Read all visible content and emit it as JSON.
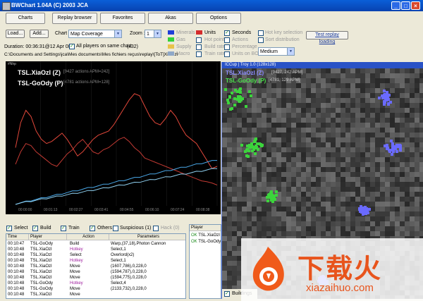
{
  "window": {
    "title": "BWChart 1.04A (C) 2003 JCA"
  },
  "tabs": [
    "Charts",
    "Replay browser",
    "Favorites",
    "Akas",
    "Options"
  ],
  "toolbar": {
    "load_label": "Load...",
    "add_label": "Add...",
    "chart_label": "Chart",
    "chart_value": "Map Coverage",
    "zoom_label": "Zoom :",
    "zoom_value": "1",
    "all_players_label": "All players on same chart",
    "zoom_factor": "(x32)",
    "duration": "Duration: 00:36:31@12 Apr 08",
    "path": "C:\\Documents and Settings\\jca\\Mes documents\\Mes fichiers reçus\\replay\\[ToT]XiaOzI",
    "test_replay_label": "Test replay loading",
    "medium_value": "Medium"
  },
  "options": {
    "minerals": "Minerals",
    "gas": "Gas",
    "supply": "Supply",
    "macro": "Macro",
    "units": "Units",
    "hot_points": "Hot points",
    "build_rate": "Build rate",
    "train_rate": "Train rate",
    "seconds": "Seconds",
    "actions": "Actions",
    "percentage": "Percentage",
    "units_on_bo": "Units on BO",
    "hot_key_selection": "Hot key selection",
    "sort_distribution": "Sort distribution"
  },
  "colors": {
    "minerals": "#1f3fd8",
    "gas": "#33d13a",
    "supply": "#e8c34a",
    "macro": "#8fa8c8",
    "units": "#d42c2c",
    "series1": "#e0473a",
    "series2": "#a8d4f0"
  },
  "graph": {
    "ylabel": "#Nhp",
    "players": [
      {
        "name": "TSL.XiaOzI (Z)",
        "stats": "[9427 actions APM=242]"
      },
      {
        "name": "TSL-GoOdy (P)",
        "stats": "[4781 actions APM=128]"
      }
    ],
    "xticks": [
      "00:00:00",
      "00:01:13",
      "00:02:27",
      "00:03:41",
      "00:04:55",
      "00:06:10",
      "00:07:24",
      "00:08:38"
    ]
  },
  "chart_data": {
    "type": "line",
    "x": [
      0,
      1,
      2,
      3,
      4,
      5,
      6,
      7,
      8,
      9,
      10,
      11,
      12,
      13,
      14,
      15,
      16,
      17,
      18,
      19,
      20,
      21,
      22,
      23,
      24,
      25,
      26,
      27,
      28,
      29,
      30,
      31,
      32,
      33,
      34,
      35,
      36,
      37,
      38,
      39
    ],
    "series": [
      {
        "name": "TSL.XiaOzI (Z)",
        "values": [
          140,
          200,
          230,
          215,
          180,
          160,
          150,
          155,
          165,
          175,
          160,
          140,
          120,
          130,
          145,
          160,
          170,
          175,
          180,
          195,
          215,
          235,
          255,
          270,
          265,
          240,
          215,
          200,
          195,
          210,
          230,
          215,
          190,
          170,
          160,
          150,
          130,
          110,
          90,
          95
        ]
      },
      {
        "name": "TSL-GoOdy (P)",
        "values": [
          100,
          130,
          150,
          145,
          130,
          120,
          110,
          100,
          95,
          110,
          125,
          135,
          150,
          160,
          145,
          130,
          125,
          135,
          140,
          150,
          160,
          165,
          155,
          140,
          130,
          115,
          110,
          105,
          100,
          95,
          90,
          85,
          80,
          75,
          70,
          65,
          60,
          58,
          55,
          50
        ]
      }
    ]
  },
  "map": {
    "header": "ICCup | Troy 1.0 (128x128)",
    "players": [
      {
        "name": "TSL.XiaOzI (Z)",
        "stats": "[9427, 242 APM]"
      },
      {
        "name": "TSL-GoOdy (P)",
        "stats": "[4781, 129 APM]"
      }
    ],
    "buildings_label": "Buildings"
  },
  "filters": {
    "select": "Select",
    "build": "Build",
    "train": "Train",
    "others": "Others",
    "suspicious": "Suspicious (1)",
    "hack": "Hack (0)"
  },
  "table": {
    "headers": [
      "Time",
      "Player",
      "Action",
      "Parameters"
    ],
    "rows": [
      {
        "time": "00:10:47",
        "player": "TSL-GoOdy",
        "action": "Build",
        "params": "Warp,(37,18),Photon Cannon"
      },
      {
        "time": "00:10:48",
        "player": "TSL.XiaOzI",
        "action": "Hotkey",
        "params": "Select,1"
      },
      {
        "time": "00:10:48",
        "player": "TSL.XiaOzI",
        "action": "Select",
        "params": "Overlord(x2)"
      },
      {
        "time": "00:10:48",
        "player": "TSL.XiaOzI",
        "action": "Hotkey",
        "params": "Select,1"
      },
      {
        "time": "00:10:48",
        "player": "TSL.XiaOzI",
        "action": "Move",
        "params": "(1607,786),0,228,0"
      },
      {
        "time": "00:10:48",
        "player": "TSL.XiaOzI",
        "action": "Move",
        "params": "(1594,787),0,228,0"
      },
      {
        "time": "00:10:48",
        "player": "TSL.XiaOzI",
        "action": "Move",
        "params": "(1594,775),0,228,0"
      },
      {
        "time": "00:10:48",
        "player": "TSL-GoOdy",
        "action": "Hotkey",
        "params": "Select,4"
      },
      {
        "time": "00:10:48",
        "player": "TSL-GoOdy",
        "action": "Move",
        "params": "(2133,732),0,228,0"
      },
      {
        "time": "00:10:48",
        "player": "TSL.XiaOzI",
        "action": "Move",
        "params": ""
      }
    ]
  },
  "player_list": {
    "header": "Player",
    "items": [
      {
        "status": "OK",
        "name": "TSL.XiaOzI"
      },
      {
        "status": "OK",
        "name": "TSL-GoOdy"
      }
    ]
  },
  "watermark": {
    "brand": "下载火",
    "url": "xiazaihuo.com"
  }
}
